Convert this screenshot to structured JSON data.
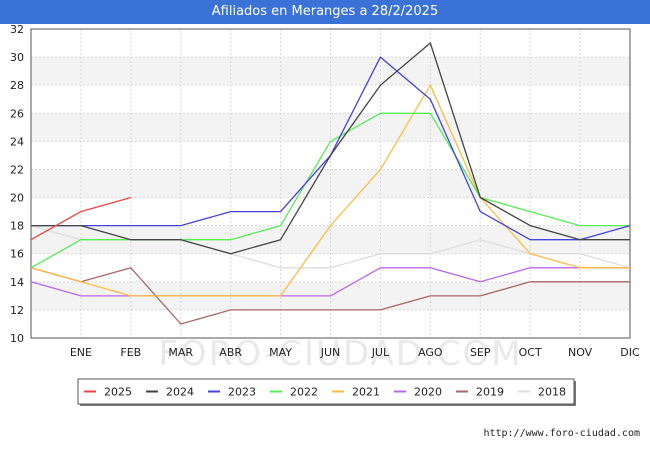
{
  "header": {
    "title": "Afiliados en Meranges a 28/2/2025"
  },
  "footer": {
    "url": "http://www.foro-ciudad.com"
  },
  "watermark": "FORO-CIUDAD.COM",
  "chart_data": {
    "type": "line",
    "title": "Afiliados en Meranges a 28/2/2025",
    "xlabel": "",
    "ylabel": "",
    "categories": [
      "",
      "ENE",
      "FEB",
      "MAR",
      "ABR",
      "MAY",
      "JUN",
      "JUL",
      "AGO",
      "SEP",
      "OCT",
      "NOV",
      "DIC"
    ],
    "ylim": [
      10,
      32
    ],
    "yticks": [
      10,
      12,
      14,
      16,
      18,
      20,
      22,
      24,
      26,
      28,
      30,
      32
    ],
    "grid": true,
    "legend_position": "bottom",
    "series": [
      {
        "name": "2025",
        "color": "#ee4444",
        "values": [
          17,
          19,
          20,
          null,
          null,
          null,
          null,
          null,
          null,
          null,
          null,
          null,
          null
        ]
      },
      {
        "name": "2024",
        "color": "#444444",
        "values": [
          18,
          18,
          17,
          17,
          16,
          17,
          23,
          28,
          31,
          20,
          18,
          17,
          17
        ]
      },
      {
        "name": "2023",
        "color": "#4444dd",
        "values": [
          18,
          18,
          18,
          18,
          19,
          19,
          23,
          30,
          27,
          19,
          17,
          17,
          18
        ]
      },
      {
        "name": "2022",
        "color": "#55ee55",
        "values": [
          15,
          17,
          17,
          17,
          17,
          18,
          24,
          26,
          26,
          20,
          19,
          18,
          18
        ]
      },
      {
        "name": "2021",
        "color": "#ffbb44",
        "values": [
          15,
          14,
          13,
          13,
          13,
          13,
          18,
          22,
          28,
          20,
          16,
          15,
          15
        ]
      },
      {
        "name": "2020",
        "color": "#bb66ee",
        "values": [
          14,
          13,
          13,
          13,
          13,
          13,
          13,
          15,
          15,
          14,
          15,
          15,
          15
        ]
      },
      {
        "name": "2019",
        "color": "#aa6666",
        "values": [
          15,
          14,
          15,
          11,
          12,
          12,
          12,
          12,
          13,
          13,
          14,
          14,
          14
        ]
      },
      {
        "name": "2018",
        "color": "#dddddd",
        "values": [
          18,
          17,
          17,
          17,
          16,
          15,
          15,
          16,
          16,
          17,
          16,
          16,
          15
        ]
      }
    ]
  }
}
